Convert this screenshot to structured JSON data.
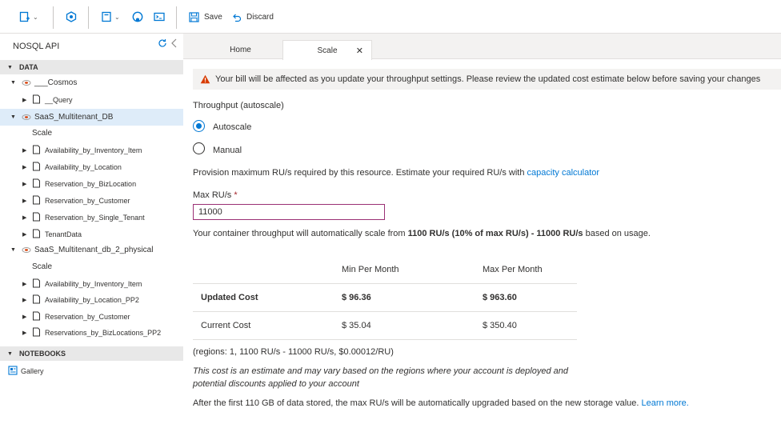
{
  "toolbar": {
    "save_label": "Save",
    "discard_label": "Discard"
  },
  "sidebar": {
    "title": "NOSQL API",
    "sections": {
      "data": "DATA",
      "notebooks": "NOTEBOOKS"
    },
    "tree": {
      "cosmos": "___Cosmos",
      "query": "__Query",
      "db1": "SaaS_Multitenant_DB",
      "db1_scale": "Scale",
      "db1_containers": [
        "Availability_by_Inventory_Item",
        "Availability_by_Location",
        "Reservation_by_BizLocation",
        "Reservation_by_Customer",
        "Reservation_by_Single_Tenant",
        "TenantData"
      ],
      "db2": "SaaS_Multitenant_db_2_physical",
      "db2_scale": "Scale",
      "db2_containers": [
        "Availability_by_Inventory_Item",
        "Availability_by_Location_PP2",
        "Reservation_by_Customer",
        "Reservations_by_BizLocations_PP2"
      ],
      "gallery": "Gallery"
    }
  },
  "tabs": [
    {
      "label": "Home"
    },
    {
      "label": "Scale"
    }
  ],
  "main": {
    "warning": "Your bill will be affected as you update your throughput settings. Please review the updated cost estimate below before saving your changes",
    "throughput_label": "Throughput (autoscale)",
    "autoscale_label": "Autoscale",
    "manual_label": "Manual",
    "provision_text": "Provision maximum RU/s required by this resource. Estimate your required RU/s with",
    "capacity_link": "capacity calculator",
    "max_ru_label": "Max RU/s",
    "required_marker": "*",
    "max_ru_value": "11000",
    "scale_prefix": "Your container throughput will automatically scale from",
    "scale_range": "1100 RU/s (10% of max RU/s) - 11000 RU/s",
    "scale_suffix": "based on usage.",
    "cost_table": {
      "headers": [
        "Min Per Month",
        "Max Per Month"
      ],
      "rows": [
        {
          "label": "Updated Cost",
          "min": "$ 96.36",
          "max": "$ 963.60"
        },
        {
          "label": "Current Cost",
          "min": "$ 35.04",
          "max": "$ 350.40"
        }
      ]
    },
    "regions_note": "(regions: 1, 1100 RU/s - 11000 RU/s, $0.00012/RU)",
    "estimate_note_1": "This cost is an estimate and may vary based on the regions where your account is deployed and",
    "estimate_note_2": "potential discounts applied to your account",
    "storage_note": "After the first 110 GB of data stored, the max RU/s will be automatically upgraded based on the new storage value.",
    "learn_more": "Learn more."
  },
  "colors": {
    "accent": "#0078d4",
    "warning": "#d83b01",
    "selected_bg": "#deecf9",
    "input_border": "#9b3075"
  }
}
